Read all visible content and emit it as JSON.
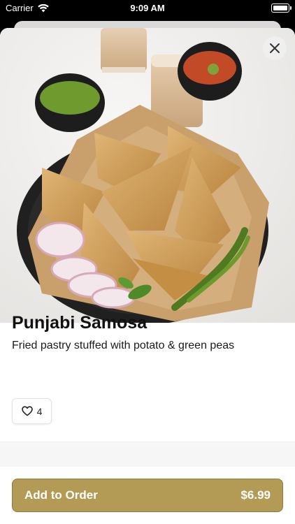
{
  "status_bar": {
    "carrier": "Carrier",
    "time": "9:09 AM"
  },
  "product": {
    "name": "Punjabi Samosa",
    "description": "Fried pastry stuffed with potato & green peas",
    "likes": "4"
  },
  "order_button": {
    "label": "Add to Order",
    "price": "$6.99"
  },
  "colors": {
    "accent": "#b39a55",
    "sheet": "#ffffff"
  },
  "icons": [
    "wifi-icon",
    "battery-icon",
    "close-icon",
    "heart-icon"
  ]
}
